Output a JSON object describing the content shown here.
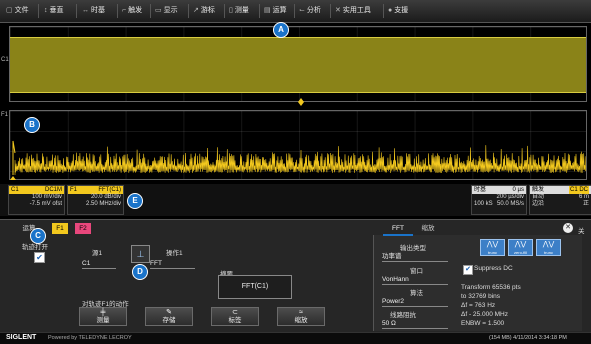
{
  "menu": {
    "items": [
      {
        "icon": "file-icon",
        "glyph": "▢",
        "label": "文件"
      },
      {
        "icon": "vertical-icon",
        "glyph": "↕",
        "label": "垂直"
      },
      {
        "icon": "timebase-icon",
        "glyph": "↔",
        "label": "时基"
      },
      {
        "icon": "trigger-icon",
        "glyph": "⌐",
        "label": "触发"
      },
      {
        "icon": "display-icon",
        "glyph": "▭",
        "label": "显示"
      },
      {
        "icon": "cursor-icon",
        "glyph": "↗",
        "label": "游标"
      },
      {
        "icon": "measure-icon",
        "glyph": "▯",
        "label": "测量"
      },
      {
        "icon": "math-icon",
        "glyph": "▤",
        "label": "运算"
      },
      {
        "icon": "analysis-icon",
        "glyph": "⌙",
        "label": "分析"
      },
      {
        "icon": "utilities-icon",
        "glyph": "✕",
        "label": "实用工具"
      },
      {
        "icon": "help-icon",
        "glyph": "●",
        "label": "支援"
      }
    ]
  },
  "callouts": [
    "A",
    "B",
    "C",
    "D",
    "E"
  ],
  "grid_labels": {
    "c1": "C1",
    "f1": "F1"
  },
  "descriptors": {
    "c1": {
      "name": "C1",
      "coupling": "DC1M",
      "scale": "100 mV/div",
      "offset": "-7.5 mV ofst"
    },
    "f1": {
      "name": "F1",
      "source": "FFT(C1)",
      "scale": "20.0 dB/div",
      "freq": "2.50 MHz/div"
    },
    "timebase": {
      "title": "时基",
      "delay": "0 µs",
      "tdiv": "200 µs/div",
      "samples": "100 kS",
      "rate": "50.0 MS/s"
    },
    "trigger": {
      "title": "触发",
      "mode": "自动",
      "type": "边沿",
      "ch_badge": "C1",
      "ch_coupling": "DC",
      "level": "6 m",
      "slope": "正"
    }
  },
  "dialog": {
    "tabs": {
      "left": "运算",
      "f1": "F1",
      "f2": "F2",
      "fft": "FFT",
      "zoom": "缩放"
    },
    "close_label": "关",
    "trace_on": {
      "label": "轨迹打开",
      "checked": true
    },
    "source1": {
      "label": "源1",
      "value": "C1"
    },
    "operator1": {
      "label": "操作1",
      "value": "FFT"
    },
    "summary": {
      "label": "摘要",
      "value": "FFT(C1)"
    },
    "actions_label": "对轨迹F1的动作",
    "buttons": [
      {
        "icon": "measure-icon",
        "glyph": "╪",
        "label": "测量"
      },
      {
        "icon": "store-icon",
        "glyph": "✎",
        "label": "存储"
      },
      {
        "icon": "label-icon",
        "glyph": "⊂",
        "label": "标签"
      },
      {
        "icon": "zoom-icon",
        "glyph": "≈",
        "label": "缩放"
      }
    ],
    "output_type": {
      "label": "输出类型",
      "value": "功率谱"
    },
    "window": {
      "label": "窗口",
      "value": "VonHann"
    },
    "algorithm": {
      "label": "算法",
      "value": "Power2"
    },
    "line_impedance": {
      "label": "线路阻抗",
      "value": "50 Ω"
    },
    "window_buttons": [
      "trunc",
      "zero-fill",
      "trunc"
    ],
    "suppress_dc": {
      "label": "Suppress DC",
      "checked": true
    },
    "info": [
      "Transform 65536 pts",
      "to 32769 bins",
      "Δf = 763 Hz",
      "Δf - 25.000 MHz",
      "ENBW = 1.500"
    ]
  },
  "status": {
    "brand": "SIGLENT",
    "powered": "Powered by TELEDYNE LECROY",
    "info": "(154 MB) 4/11/2014 3:34:18 PM"
  },
  "colors": {
    "c1": "#f2c81e",
    "f1": "#f2c81e",
    "f2": "#e8477c",
    "accent": "#1a73c9"
  }
}
